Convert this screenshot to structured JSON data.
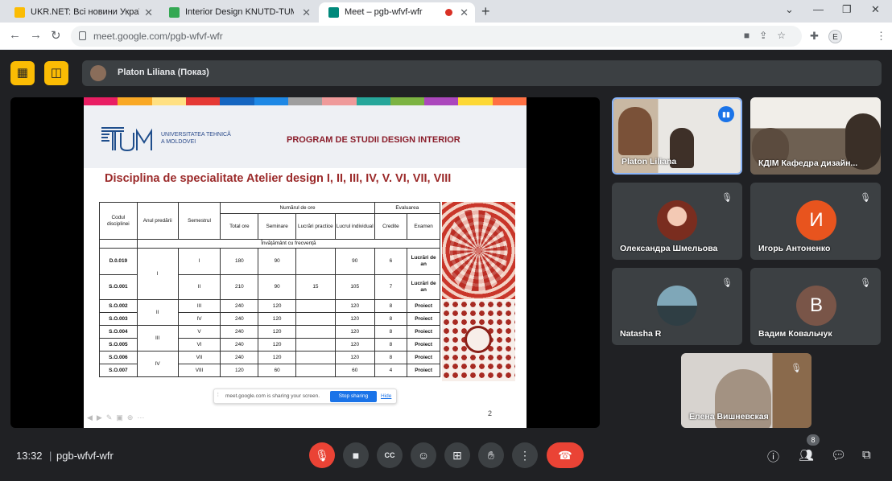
{
  "browser": {
    "tabs": [
      {
        "title": "UKR.NET: Всі новини України, с",
        "favicon_color": "#fbbc04"
      },
      {
        "title": "Interior Design KNUTD-TUM • ел",
        "favicon_color": "#34a853"
      },
      {
        "title": "Meet – pgb-wfvf-wfr",
        "favicon_color": "#00897b"
      }
    ],
    "url": "meet.google.com/pgb-wfvf-wfr",
    "profile_initial": "E"
  },
  "presenter": {
    "label": "Platon Liliana (Показ)"
  },
  "slide": {
    "university": [
      "UNIVERSITATEA TEHNICĂ",
      "A MOLDOVEI"
    ],
    "program": "PROGRAM DE  STUDII DESIGN INTERIOR",
    "discipline": "Disciplina de specialitate Atelier design I, II, III, IV, V. VI, VII, VIII",
    "stripe_colors": [
      "#e91e63",
      "#f9a825",
      "#ffe082",
      "#e53935",
      "#1565c0",
      "#1e88e5",
      "#9e9e9e",
      "#ef9a9a",
      "#26a69a",
      "#7cb342",
      "#ab47bc",
      "#fdd835",
      "#ff7043"
    ],
    "table": {
      "h_code": "Codul disciplinei",
      "h_year": "Anul predării",
      "h_sem": "Semestrul",
      "h_hours": "Numărul de ore",
      "h_eval": "Evaluarea",
      "h_total": "Total ore",
      "h_seminar": "Seminare",
      "h_practical": "Lucrări practice",
      "h_individual": "Lucrul individual",
      "h_credits": "Credite",
      "h_exam": "Examen",
      "mode": "Învățământ cu frecvență",
      "rows": [
        {
          "code": "D.0.019",
          "year": "I",
          "sem": "I",
          "total": "180",
          "seminar": "90",
          "practical": "",
          "individual": "90",
          "credits": "6",
          "exam": "Lucrări de an"
        },
        {
          "code": "S.O.001",
          "year": "",
          "sem": "II",
          "total": "210",
          "seminar": "90",
          "practical": "15",
          "individual": "105",
          "credits": "7",
          "exam": "Lucrări de an"
        },
        {
          "code": "S.O.002",
          "year": "II",
          "sem": "III",
          "total": "240",
          "seminar": "120",
          "practical": "",
          "individual": "120",
          "credits": "8",
          "exam": "Proiect"
        },
        {
          "code": "S.O.003",
          "year": "",
          "sem": "IV",
          "total": "240",
          "seminar": "120",
          "practical": "",
          "individual": "120",
          "credits": "8",
          "exam": "Proiect"
        },
        {
          "code": "S.O.004",
          "year": "III",
          "sem": "V",
          "total": "240",
          "seminar": "120",
          "practical": "",
          "individual": "120",
          "credits": "8",
          "exam": "Proiect"
        },
        {
          "code": "S.O.005",
          "year": "",
          "sem": "VI",
          "total": "240",
          "seminar": "120",
          "practical": "",
          "individual": "120",
          "credits": "8",
          "exam": "Proiect"
        },
        {
          "code": "S.O.006",
          "year": "IV",
          "sem": "VII",
          "total": "240",
          "seminar": "120",
          "practical": "",
          "individual": "120",
          "credits": "8",
          "exam": "Proiect"
        },
        {
          "code": "S.O.007",
          "year": "",
          "sem": "VIII",
          "total": "120",
          "seminar": "60",
          "practical": "",
          "individual": "60",
          "credits": "4",
          "exam": "Proiect"
        }
      ]
    },
    "share_notice": "meet.google.com is sharing your screen.",
    "stop_sharing": "Stop sharing",
    "hide": "Hide",
    "page_number": "2"
  },
  "participants": [
    {
      "name": "Platon Liliana",
      "type": "video",
      "speaking": true
    },
    {
      "name": "КДІМ Кафедра дизайн...",
      "type": "video"
    },
    {
      "name": "Олександра Шмельова",
      "type": "photo",
      "muted": true
    },
    {
      "name": "Игорь Антоненко",
      "type": "initial",
      "initial": "И",
      "color": "#e8541e",
      "muted": true
    },
    {
      "name": "Natasha R",
      "type": "photo",
      "muted": true
    },
    {
      "name": "Вадим Ковальчук",
      "type": "initial",
      "initial": "В",
      "color": "#795548",
      "muted": true
    },
    {
      "name": "Елена Вишневская",
      "type": "video",
      "muted": true
    }
  ],
  "bottom": {
    "time": "13:32",
    "meeting_code": "pgb-wfvf-wfr",
    "participant_count": "8"
  }
}
